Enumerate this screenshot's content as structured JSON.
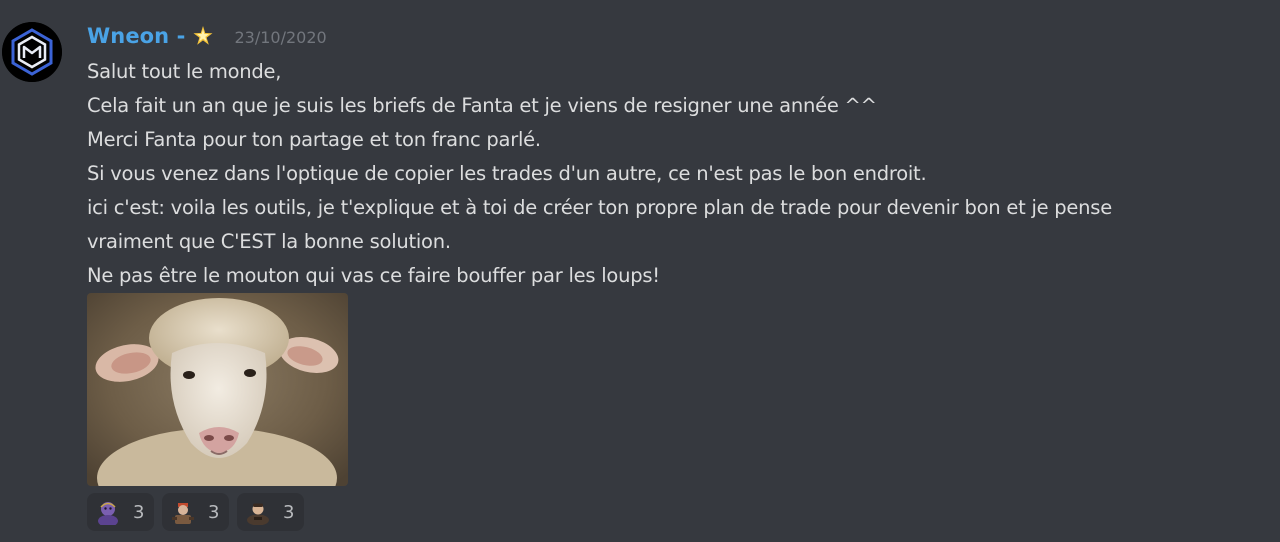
{
  "message": {
    "author": "Wneon -",
    "author_badge_icon": "star-icon",
    "timestamp": "23/10/2020",
    "lines": [
      "Salut tout le monde,",
      "Cela fait un an que je suis les briefs de Fanta et je viens de resigner une année ^^",
      "Merci Fanta pour ton partage et ton franc parlé.",
      "Si vous venez dans l'optique de copier les trades d'un autre, ce n'est pas le bon endroit.",
      "ici c'est: voila les outils, je t'explique et à toi de créer ton propre plan de trade pour devenir bon et je pense",
      "vraiment que C'EST la bonne solution.",
      "Ne pas être le mouton qui vas ce faire bouffer par les loups!"
    ],
    "attachment_icon": "sheep-image"
  },
  "reactions": [
    {
      "emoji": "purple-character-emoji",
      "count": "3"
    },
    {
      "emoji": "soldier-character-emoji",
      "count": "3"
    },
    {
      "emoji": "character-bust-emoji",
      "count": "3"
    }
  ],
  "colors": {
    "background": "#36393f",
    "username": "#4aa3e6",
    "text": "#dcddde",
    "timestamp": "#72767d",
    "reaction_bg": "#2f3136"
  }
}
